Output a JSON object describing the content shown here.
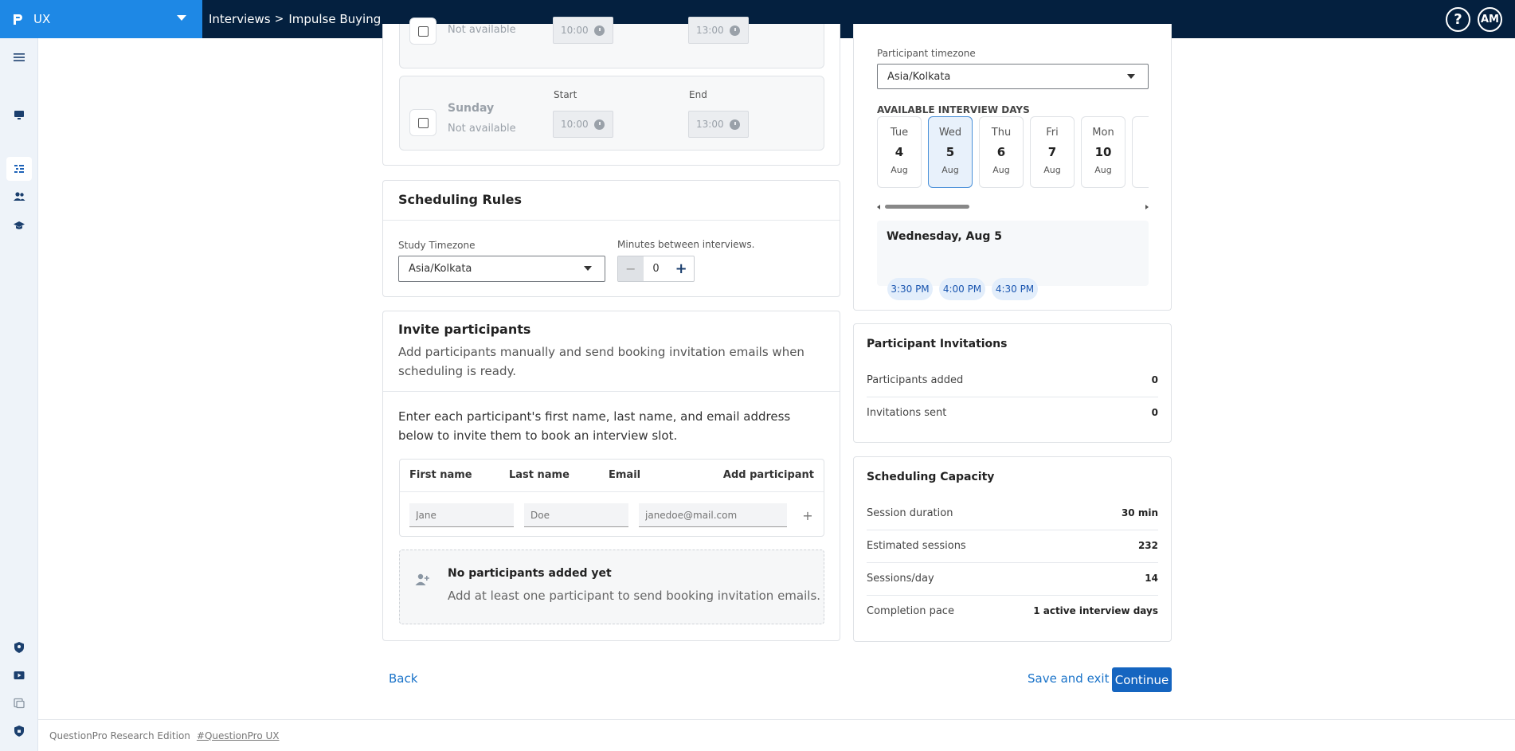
{
  "topbar": {
    "app_name": "UX",
    "breadcrumb": {
      "parent": "Interviews",
      "separator": ">",
      "current": "Impulse Buying"
    },
    "help_label": "?",
    "avatar_initials": "AM"
  },
  "availability": {
    "saturday": {
      "status": "Not available",
      "start": "10:00",
      "end": "13:00"
    },
    "sunday": {
      "name": "Sunday",
      "status": "Not available",
      "start_label": "Start",
      "end_label": "End",
      "start": "10:00",
      "end": "13:00"
    }
  },
  "scheduling_rules": {
    "title": "Scheduling Rules",
    "timezone_label": "Study Timezone",
    "timezone_value": "Asia/Kolkata",
    "minutes_label": "Minutes between interviews.",
    "minutes_value": "0",
    "minus": "−",
    "plus": "+"
  },
  "invite": {
    "title": "Invite participants",
    "description": "Add participants manually and send booking invitation emails when scheduling is ready.",
    "instructions": "Enter each participant's first name, last name, and email address below to invite them to book an interview slot.",
    "columns": [
      "First name",
      "Last name",
      "Email",
      "Add participant"
    ],
    "placeholders": {
      "first": "Jane",
      "last": "Doe",
      "email": "janedoe@mail.com"
    },
    "add_symbol": "+",
    "empty_title": "No participants added yet",
    "empty_text": "Add at least one participant to send booking invitation emails."
  },
  "preview": {
    "tz_label": "Participant timezone",
    "tz_value": "Asia/Kolkata",
    "days_heading": "AVAILABLE INTERVIEW DAYS",
    "days": [
      {
        "dow": "Tue",
        "num": "4",
        "mon": "Aug",
        "selected": false
      },
      {
        "dow": "Wed",
        "num": "5",
        "mon": "Aug",
        "selected": true
      },
      {
        "dow": "Thu",
        "num": "6",
        "mon": "Aug",
        "selected": false
      },
      {
        "dow": "Fri",
        "num": "7",
        "mon": "Aug",
        "selected": false
      },
      {
        "dow": "Mon",
        "num": "10",
        "mon": "Aug",
        "selected": false
      }
    ],
    "selected_date": "Wednesday, Aug 5",
    "slots": [
      "3:30 PM",
      "4:00 PM",
      "4:30 PM"
    ]
  },
  "invitations": {
    "title": "Participant Invitations",
    "rows": [
      {
        "label": "Participants added",
        "value": "0"
      },
      {
        "label": "Invitations sent",
        "value": "0"
      }
    ]
  },
  "capacity": {
    "title": "Scheduling Capacity",
    "rows": [
      {
        "label": "Session duration",
        "value": "30 min"
      },
      {
        "label": "Estimated sessions",
        "value": "232"
      },
      {
        "label": "Sessions/day",
        "value": "14"
      },
      {
        "label": "Completion pace",
        "value": "1 active interview days"
      }
    ]
  },
  "actions": {
    "back": "Back",
    "save_exit": "Save and exit",
    "continue": "Continue"
  },
  "footer": {
    "edition": "QuestionPro Research Edition",
    "tag": "#QuestionPro UX"
  },
  "colors": {
    "topbar": "#04203f",
    "app_switch": "#1e88e5",
    "primary": "#1565c0",
    "rail": "#eef3f9"
  },
  "icons": [
    "hamburger-icon",
    "monitor-icon",
    "workflow-icon",
    "people-icon",
    "graduation-cap-icon",
    "shield-icon",
    "video-icon",
    "gallery-icon",
    "shield-lock-icon",
    "clock-icon",
    "add-person-icon"
  ]
}
